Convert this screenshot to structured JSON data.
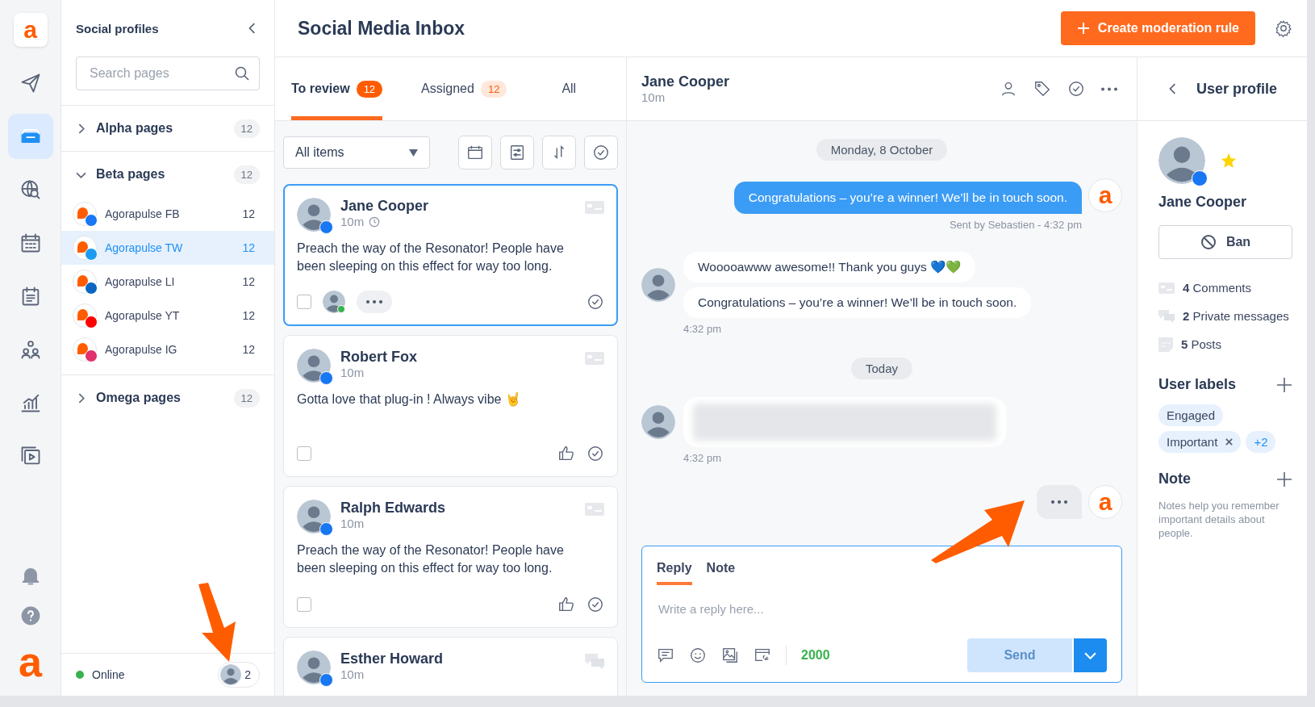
{
  "rail": {
    "logo": "a",
    "items": [
      {
        "kind": "send",
        "selected": false
      },
      {
        "kind": "inbox",
        "selected": true
      },
      {
        "kind": "globe",
        "selected": false
      },
      {
        "kind": "calendar",
        "selected": false
      },
      {
        "kind": "notes",
        "selected": false
      },
      {
        "kind": "people",
        "selected": false
      },
      {
        "kind": "chart",
        "selected": false
      },
      {
        "kind": "media",
        "selected": false
      }
    ],
    "bottom": [
      {
        "kind": "bell"
      },
      {
        "kind": "help"
      }
    ],
    "brand_mark": "a"
  },
  "profiles_panel": {
    "title": "Social profiles",
    "search": {
      "placeholder": "Search pages"
    },
    "groups": [
      {
        "name": "Alpha pages",
        "count": "12",
        "expanded": false
      },
      {
        "name": "Beta pages",
        "count": "12",
        "expanded": true,
        "children": [
          {
            "name": "Agorapulse FB",
            "kind": "facebook",
            "count": "12",
            "selected": false
          },
          {
            "name": "Agorapulse TW",
            "kind": "twitter",
            "count": "12",
            "selected": true
          },
          {
            "name": "Agorapulse LI",
            "kind": "linkedin",
            "count": "12",
            "selected": false
          },
          {
            "name": "Agorapulse YT",
            "kind": "youtube",
            "count": "12",
            "selected": false
          },
          {
            "name": "Agorapulse IG",
            "kind": "instagram",
            "count": "12",
            "selected": false
          }
        ]
      },
      {
        "name": "Omega pages",
        "count": "12",
        "expanded": false
      }
    ],
    "status": {
      "label": "Online",
      "online": true,
      "count": "2"
    }
  },
  "header": {
    "title": "Social Media Inbox",
    "action": "Create moderation rule"
  },
  "tabs": [
    {
      "label": "To review",
      "count": "12",
      "selected": true
    },
    {
      "label": "Assigned",
      "count": "12",
      "selected": false
    },
    {
      "label": "All",
      "selected": false
    }
  ],
  "filter": {
    "value": "All items"
  },
  "posts": [
    {
      "author": "Jane Cooper",
      "time": "10m",
      "pending": true,
      "kind": "comment",
      "text": "Preach the way of the Resonator! People have been sleeping on this effect for way too long.",
      "selected": true,
      "checked": false,
      "assigned": true
    },
    {
      "author": "Robert Fox",
      "time": "10m",
      "pending": false,
      "kind": "comment",
      "text": "Gotta love that plug-in ! Always vibe 🤘",
      "selected": false,
      "checked": false,
      "assigned": false
    },
    {
      "author": "Ralph Edwards",
      "time": "10m",
      "pending": false,
      "kind": "comment",
      "text": "Preach the way of the Resonator! People have been sleeping on this effect for way too long.",
      "selected": false,
      "checked": false,
      "assigned": false
    },
    {
      "author": "Esther Howard",
      "time": "10m",
      "pending": false,
      "kind": "message",
      "selected": false,
      "assigned": false
    }
  ],
  "conversation": {
    "name": "Jane Cooper",
    "time": "10m",
    "messages": [
      {
        "kind": "date",
        "text": "Monday, 8 October"
      },
      {
        "kind": "outgoing",
        "text": "Congratulations – you’re a winner! We’ll be in touch soon.",
        "meta": "Sent by Sebastien - 4:32 pm",
        "avatar": "a"
      },
      {
        "kind": "incoming",
        "texts": [
          "Wooooawww awesome!! Thank you guys 💙💚",
          "Congratulations – you’re a winner! We’ll be in touch soon."
        ],
        "time": "4:32 pm"
      },
      {
        "kind": "date",
        "text": "Today"
      },
      {
        "kind": "blurred",
        "time": "4:32 pm"
      },
      {
        "kind": "typing",
        "avatar": "a"
      }
    ]
  },
  "composer": {
    "tabs": [
      {
        "label": "Reply",
        "selected": true
      },
      {
        "label": "Note",
        "selected": false
      }
    ],
    "placeholder": "Write a reply here...",
    "counter": "2000",
    "send": "Send",
    "send_disabled": true
  },
  "profile": {
    "title": "User profile",
    "name": "Jane Cooper",
    "starred": true,
    "ban": "Ban",
    "stats": [
      {
        "kind": "comments",
        "count": "4",
        "label": "Comments"
      },
      {
        "kind": "messages",
        "count": "2",
        "label": "Private messages"
      },
      {
        "kind": "posts",
        "count": "5",
        "label": "Posts"
      }
    ],
    "labels_title": "User labels",
    "labels": [
      {
        "text": "Engaged",
        "removable": false
      },
      {
        "text": "Important",
        "removable": true
      }
    ],
    "more_labels": "+2",
    "note_title": "Note",
    "note_hint": "Notes help you remember important details about people."
  }
}
